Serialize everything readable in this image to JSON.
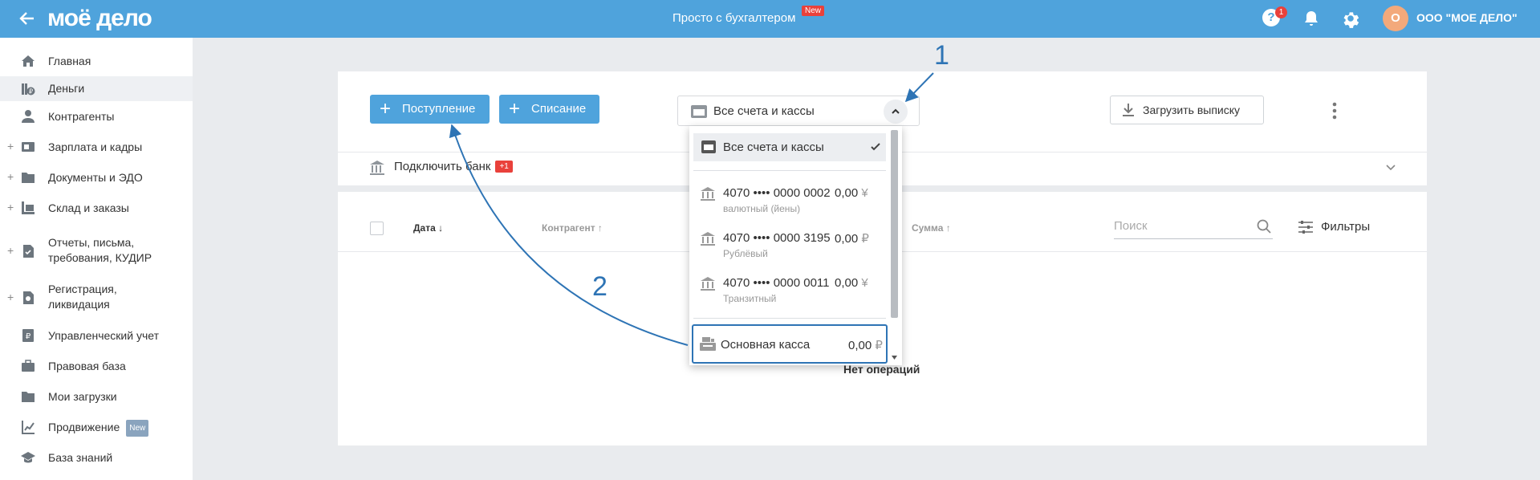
{
  "topbar": {
    "logo": "моё дело",
    "center_title": "Просто с бухгалтером",
    "center_badge": "New",
    "help_count": "1",
    "help_glyph": "?",
    "avatar_letter": "О",
    "org_name": "ООО \"МОЕ ДЕЛО\""
  },
  "sidebar": {
    "items": [
      {
        "label": "Главная",
        "icon": "home-icon"
      },
      {
        "label": "Деньги",
        "icon": "money-icon"
      },
      {
        "label": "Контрагенты",
        "icon": "contractors-icon"
      },
      {
        "label": "Зарплата и кадры",
        "icon": "salary-icon",
        "expand": "+"
      },
      {
        "label": "Документы и ЭДО",
        "icon": "folder-icon",
        "expand": "+"
      },
      {
        "label": "Склад и заказы",
        "icon": "warehouse-icon",
        "expand": "+"
      },
      {
        "label": "Отчеты, письма,",
        "label2": "требования, КУДИР",
        "icon": "reports-icon",
        "expand": "+"
      },
      {
        "label": "Регистрация,",
        "label2": "ликвидация",
        "icon": "registration-icon",
        "expand": "+"
      },
      {
        "label": "Управленческий учет",
        "icon": "management-icon"
      },
      {
        "label": "Правовая база",
        "icon": "briefcase-icon"
      },
      {
        "label": "Мои загрузки",
        "icon": "folder-icon"
      },
      {
        "label": "Продвижение",
        "icon": "promotion-icon",
        "badge": "New"
      },
      {
        "label": "База знаний",
        "icon": "graduation-cap-icon"
      }
    ]
  },
  "toolbar": {
    "income_label": "Поступление",
    "expense_label": "Списание",
    "account_select_label": "Все счета и кассы",
    "download_label": "Загрузить выписку"
  },
  "bank": {
    "label": "Подключить банк",
    "badge": "+1"
  },
  "table": {
    "col_date": "Дата ↓",
    "col_contractor": "Контрагент ↑",
    "col_sum": "Сумма ↑",
    "search_placeholder": "Поиск",
    "filters_label": "Фильтры",
    "empty_text": "Нет операций"
  },
  "dropdown": {
    "all_label": "Все счета и кассы",
    "accounts": [
      {
        "number": "4070 •••• 0000 0002",
        "type": "валютный (йены)",
        "amount": "0,00",
        "currency": "¥"
      },
      {
        "number": "4070 •••• 0000 3195",
        "type": "Рублёвый",
        "amount": "0,00",
        "currency": "₽"
      },
      {
        "number": "4070 •••• 0000 0011",
        "type": "Транзитный",
        "amount": "0,00",
        "currency": "¥"
      }
    ],
    "cash": {
      "label": "Основная касса",
      "amount": "0,00",
      "currency": "₽"
    }
  },
  "annotations": {
    "one": "1",
    "two": "2"
  },
  "colors": {
    "brand": "#4fa3dc",
    "annotation": "#2e74b5",
    "badge_red": "#e9413b"
  }
}
